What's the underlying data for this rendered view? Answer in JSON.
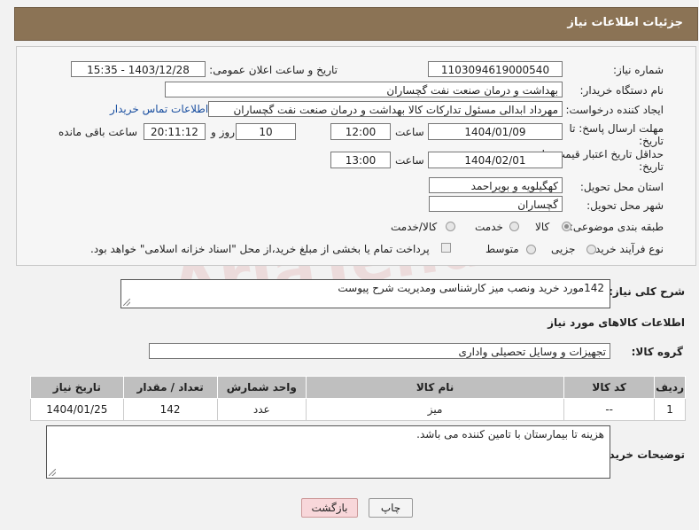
{
  "header": {
    "title": "جزئیات اطلاعات نیاز"
  },
  "form": {
    "need_number_label": "شماره نیاز:",
    "need_number": "1103094619000540",
    "announce_label": "تاریخ و ساعت اعلان عمومی:",
    "announce_value": "1403/12/28 - 15:35",
    "buyer_org_label": "نام دستگاه خریدار:",
    "buyer_org": "بهداشت و درمان صنعت نفت گچساران",
    "creator_label": "ایجاد کننده درخواست:",
    "creator": "مهرداد ابدالی مسئول تدارکات کالا  بهداشت و درمان صنعت نفت گچساران",
    "contact_link": "اطلاعات تماس خریدار",
    "deadline_label_1": "مهلت ارسال پاسخ: تا",
    "deadline_label_2": "تاریخ:",
    "deadline_date": "1404/01/09",
    "time_label": "ساعت",
    "deadline_time": "12:00",
    "days_value": "10",
    "days_label": "روز و",
    "remaining_time": "20:11:12",
    "remaining_label": "ساعت باقی مانده",
    "validity_label_1": "حداقل تاریخ اعتبار قیمت: تا",
    "validity_label_2": "تاریخ:",
    "validity_date": "1404/02/01",
    "validity_time_label": "ساعت",
    "validity_time": "13:00",
    "province_label": "استان محل تحویل:",
    "province": "کهگیلویه و بویراحمد",
    "city_label": "شهر محل تحویل:",
    "city": "گچساران",
    "category_label": "طبقه بندی موضوعی:",
    "category_options": [
      "کالا",
      "خدمت",
      "کالا/خدمت"
    ],
    "category_selected": "کالا",
    "process_label": "نوع فرآیند خرید :",
    "process_options": [
      "جزیی",
      "متوسط"
    ],
    "process_note": "پرداخت تمام یا بخشی از مبلغ خرید،از محل \"اسناد خزانه اسلامی\" خواهد بود."
  },
  "description": {
    "label": "شرح کلی نیاز:",
    "value": "142مورد  خرید ونصب میز کارشناسی ومدیریت شرح پیوست"
  },
  "goods": {
    "section_title": "اطلاعات کالاهای مورد نیاز",
    "group_label": "گروه کالا:",
    "group_value": "تجهیزات و وسایل تحصیلی واداری",
    "columns": [
      "ردیف",
      "کد کالا",
      "نام کالا",
      "واحد شمارش",
      "تعداد / مقدار",
      "تاریخ نیاز"
    ],
    "rows": [
      [
        "1",
        "--",
        "میز",
        "عدد",
        "142",
        "1404/01/25"
      ]
    ]
  },
  "buyer_notes": {
    "label": "توضیحات خریدار:",
    "value": "هزینه تا بیمارستان با تامین کننده می باشد."
  },
  "buttons": {
    "print": "چاپ",
    "back": "بازگشت"
  },
  "watermark": "AriaTender.net",
  "colors": {
    "header_bg": "#8b7355",
    "table_header_bg": "#bfbfbf",
    "link": "#1a4fa0",
    "back_button_bg": "#f8d7da"
  }
}
